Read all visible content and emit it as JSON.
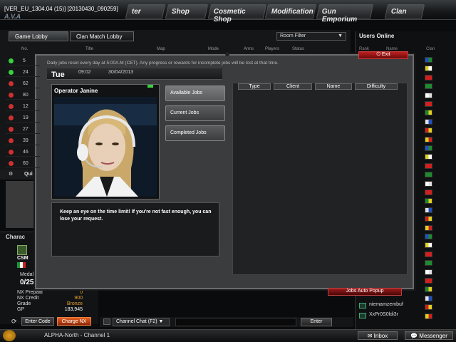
{
  "top": {
    "version": "[VER_EU_1304.04 (15)] [20130430_090259]",
    "logo": "A.V.A",
    "tabs": [
      "Shop",
      "Cosmetic Shop",
      "Modification",
      "Gun Emporium",
      "Clan"
    ],
    "partial_tab": "ter"
  },
  "lobby": {
    "tabs": [
      "Game Lobby",
      "Clan Match Lobby"
    ],
    "room_filter": "Room Filter",
    "columns": [
      "No.",
      "Title",
      "Map",
      "Mode",
      "Arms",
      "Players",
      "Status"
    ],
    "rooms": [
      {
        "no": "5",
        "state": "green"
      },
      {
        "no": "24",
        "state": "green"
      },
      {
        "no": "62",
        "state": "red"
      },
      {
        "no": "80",
        "state": "red"
      },
      {
        "no": "12",
        "state": "red"
      },
      {
        "no": "19",
        "state": "red"
      },
      {
        "no": "27",
        "state": "red"
      },
      {
        "no": "39",
        "state": "red"
      },
      {
        "no": "46",
        "state": "red"
      },
      {
        "no": "60",
        "state": "red"
      }
    ],
    "quick_label": "Qui"
  },
  "users": {
    "title": "Users Online",
    "columns": [
      "Rank",
      "Name",
      "Clan"
    ],
    "visible_names": [
      "niemamzembuf",
      "XxPr0S0ldi3r"
    ]
  },
  "character": {
    "title": "Charac",
    "rank_label": "CSM",
    "medal_label": "Medal",
    "medal_value": "0/25",
    "stats": [
      {
        "label": "NX Prepaid",
        "value": "0"
      },
      {
        "label": "NX Credit",
        "value": "900"
      },
      {
        "label": "Grade",
        "value": "Bronze"
      },
      {
        "label": "GP",
        "value": "183,945"
      }
    ],
    "enter_code": "Enter Code",
    "charge_nx": "Charge NX"
  },
  "chat": {
    "channel_select": "Channel Chat (F2)",
    "enter": "Enter"
  },
  "status": {
    "channel": "ALPHA-North - Channel 1",
    "inbox": "Inbox",
    "messenger": "Messenger"
  },
  "modal": {
    "notice": "Daily jobs reset every day at 5:00A.M (CET). Any progress or rewards for incomplete jobs will be lost at that time.",
    "exit": "Exit",
    "day": "Tue",
    "time": "09:02",
    "date": "30/04/2013",
    "operator_name": "Operator Janine",
    "message": "Keep an eye on the time limit! If you're not fast enough, you can lose your request.",
    "job_tabs": [
      "Available Jobs",
      "Current Jobs",
      "Completed Jobs"
    ],
    "job_columns": [
      "Type",
      "Client",
      "Name",
      "Difficulty"
    ],
    "auto_popup": "Jobs Auto Popup"
  },
  "colors": {
    "accent_red": "#c02020",
    "online_green": "#3ad040",
    "offline_red": "#d03030",
    "gold": "#e8a030"
  }
}
